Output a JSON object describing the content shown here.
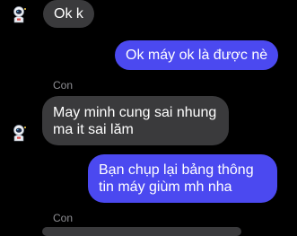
{
  "chat": {
    "messages": [
      {
        "direction": "incoming",
        "text": "Ok k"
      },
      {
        "direction": "outgoing",
        "text": "Ok máy ok là được nè"
      },
      {
        "direction": "incoming",
        "sender": "Con",
        "text": "May minh cung sai nhung\nma it sai lăm"
      },
      {
        "direction": "outgoing",
        "text": "Bạn chụp lại bảng thông\ntin máy giùm mh nha"
      },
      {
        "direction": "incoming",
        "sender": "Con",
        "text": ""
      }
    ]
  },
  "avatar": {
    "icon": "astronaut-avatar-icon"
  },
  "colors": {
    "background": "#000000",
    "incoming_bubble": "#3a3a3c",
    "outgoing_bubble": "#4b49f0",
    "sender_label": "#8e8e93",
    "text": "#ffffff"
  }
}
